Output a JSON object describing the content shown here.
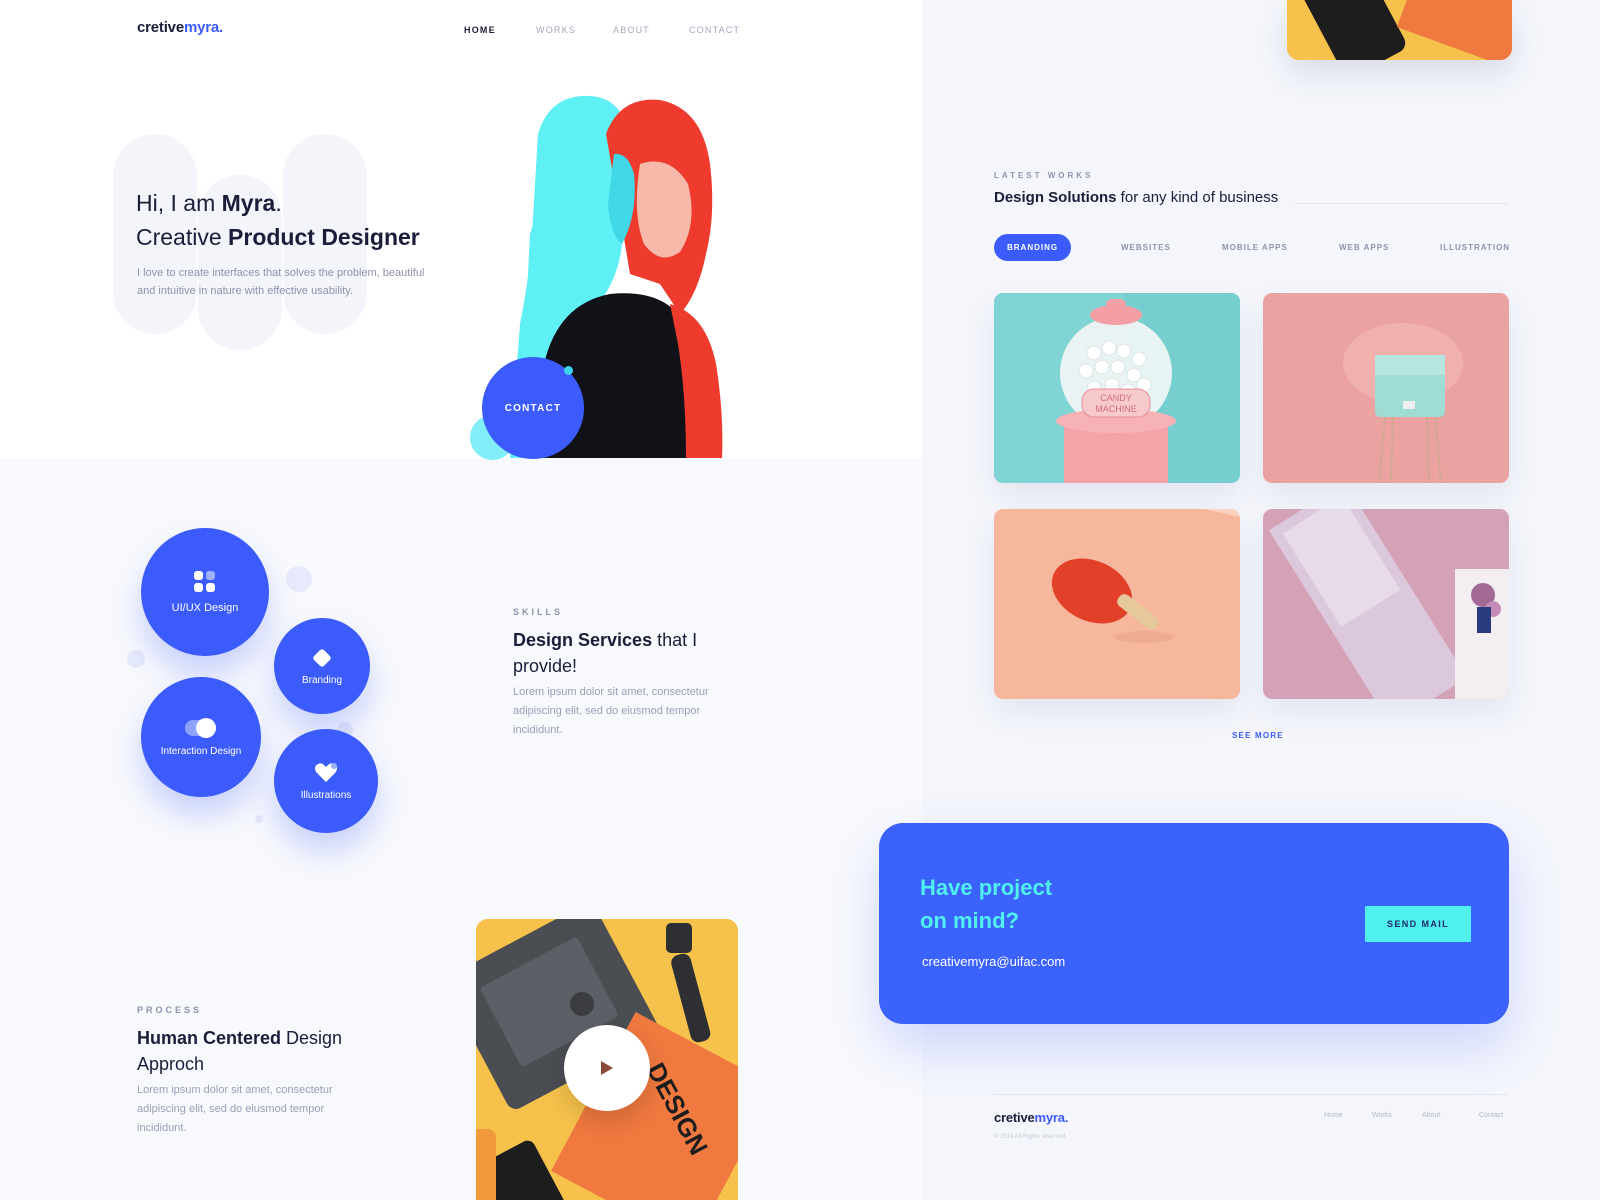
{
  "brand": {
    "name_prefix": "cretive",
    "name_suffix": "myra."
  },
  "nav": {
    "items": [
      "HOME",
      "WORKS",
      "ABOUT",
      "CONTACT"
    ],
    "active": "HOME"
  },
  "hero": {
    "greeting_pre": "Hi, I am ",
    "name": "Myra",
    "greeting_post": ".",
    "role_pre": "Creative ",
    "role": "Product Designer",
    "description": "I love to create interfaces that solves the problem, beautiful and intuitive in nature with effective usability.",
    "contact_label": "CONTACT"
  },
  "skills": {
    "kicker": "SKILLS",
    "title_bold": "Design Services",
    "title_rest": " that I provide!",
    "description": "Lorem ipsum dolor sit amet, consectetur adipiscing elit, sed do eiusmod tempor incididunt.",
    "items": [
      "UI/UX Design",
      "Branding",
      "Interaction Design",
      "Illustrations"
    ]
  },
  "process": {
    "kicker": "PROCESS",
    "title_bold": "Human  Centered",
    "title_rest": " Design Approch",
    "description": "Lorem ipsum dolor sit amet, consectetur adipiscing elit, sed do eiusmod tempor incididunt.",
    "video_text": "DESIGN"
  },
  "works": {
    "kicker": "LATEST WORKS",
    "title_bold": "Design Solutions",
    "title_rest": " for any kind of business",
    "tabs": [
      "BRANDING",
      "WEBSITES",
      "MOBILE APPS",
      "WEB APPS",
      "ILLUSTRATION"
    ],
    "active_tab": "BRANDING",
    "candy_label_1": "CANDY",
    "candy_label_2": "MACHINE",
    "see_more": "SEE MORE"
  },
  "cta": {
    "title_line1": "Have project",
    "title_line2": "on mind?",
    "email": "creativemyra@uifac.com",
    "button": "SEND MAIL"
  },
  "footer": {
    "links": [
      "Home",
      "Works",
      "About",
      "Contact"
    ],
    "copyright": "© 2019 All Rights reserved"
  },
  "colors": {
    "accent": "#3b5bfc",
    "cyan": "#4ff0ee",
    "dark": "#1b1d3a",
    "muted": "#8d93ab"
  },
  "icons": [
    "grid-icon",
    "diamond-icon",
    "toggle-icon",
    "heart-icon",
    "play-icon"
  ]
}
